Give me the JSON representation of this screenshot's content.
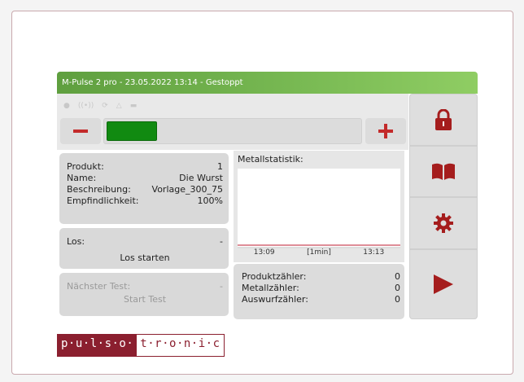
{
  "title": "M-Pulse 2 pro - 23.05.2022 13:14 - Gestoppt",
  "colors": {
    "accent_red": "#c32a2a",
    "level_green": "#118a11",
    "brand": "#8b1f2f",
    "titlebar_green": "#77b852"
  },
  "status_icons": [
    "sensor-icon",
    "signal-icon",
    "sync-icon",
    "warning-icon",
    "battery-icon"
  ],
  "sensitivity_level_fraction": 0.2,
  "product": {
    "label_product": "Produkt:",
    "product_value": "1",
    "label_name": "Name:",
    "name_value": "Die Wurst",
    "label_desc": "Beschreibung:",
    "desc_value": "Vorlage_300_75",
    "label_sens": "Empfindlichkeit:",
    "sens_value": "100%"
  },
  "lot": {
    "label": "Los:",
    "value": "-",
    "start_label": "Los starten"
  },
  "next_test": {
    "label": "Nächster Test:",
    "value": "-",
    "start_label": "Start Test"
  },
  "metal_stats": {
    "title": "Metallstatistik:",
    "ticks": [
      "13:09",
      "[1min]",
      "13:13"
    ]
  },
  "counters": {
    "product_label": "Produktzähler:",
    "product_value": "0",
    "metal_label": "Metallzähler:",
    "metal_value": "0",
    "reject_label": "Auswurfzähler:",
    "reject_value": "0"
  },
  "side_buttons": [
    "lock-icon",
    "manual-icon",
    "settings-icon",
    "play-icon"
  ],
  "logo": {
    "part1": "p·u·l·s·o·",
    "part2": "t·r·o·n·i·c"
  }
}
